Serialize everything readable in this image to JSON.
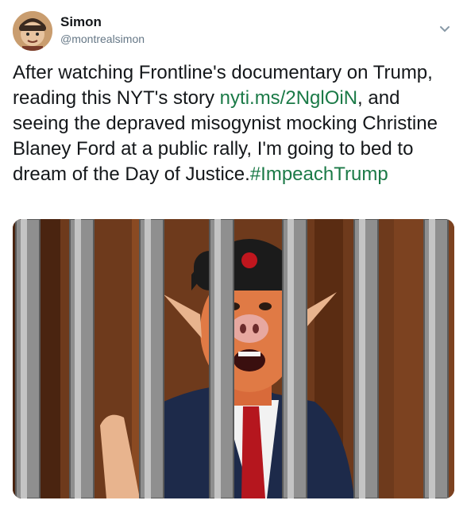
{
  "tweet": {
    "display_name": "Simon",
    "handle": "@montrealsimon",
    "text_before_link": "After watching Frontline's documentary on Trump, reading this NYT's story ",
    "link_text": "nyti.ms/2NglOiN",
    "text_after_link": ", and seeing the depraved misogynist mocking Christine Blaney Ford at a public rally, I'm going to bed to dream of the Day of Justice.",
    "hashtag": "#ImpeachTrump",
    "media_icon": "caricature-behind-bars-image",
    "link_color": "#1b7a47"
  }
}
